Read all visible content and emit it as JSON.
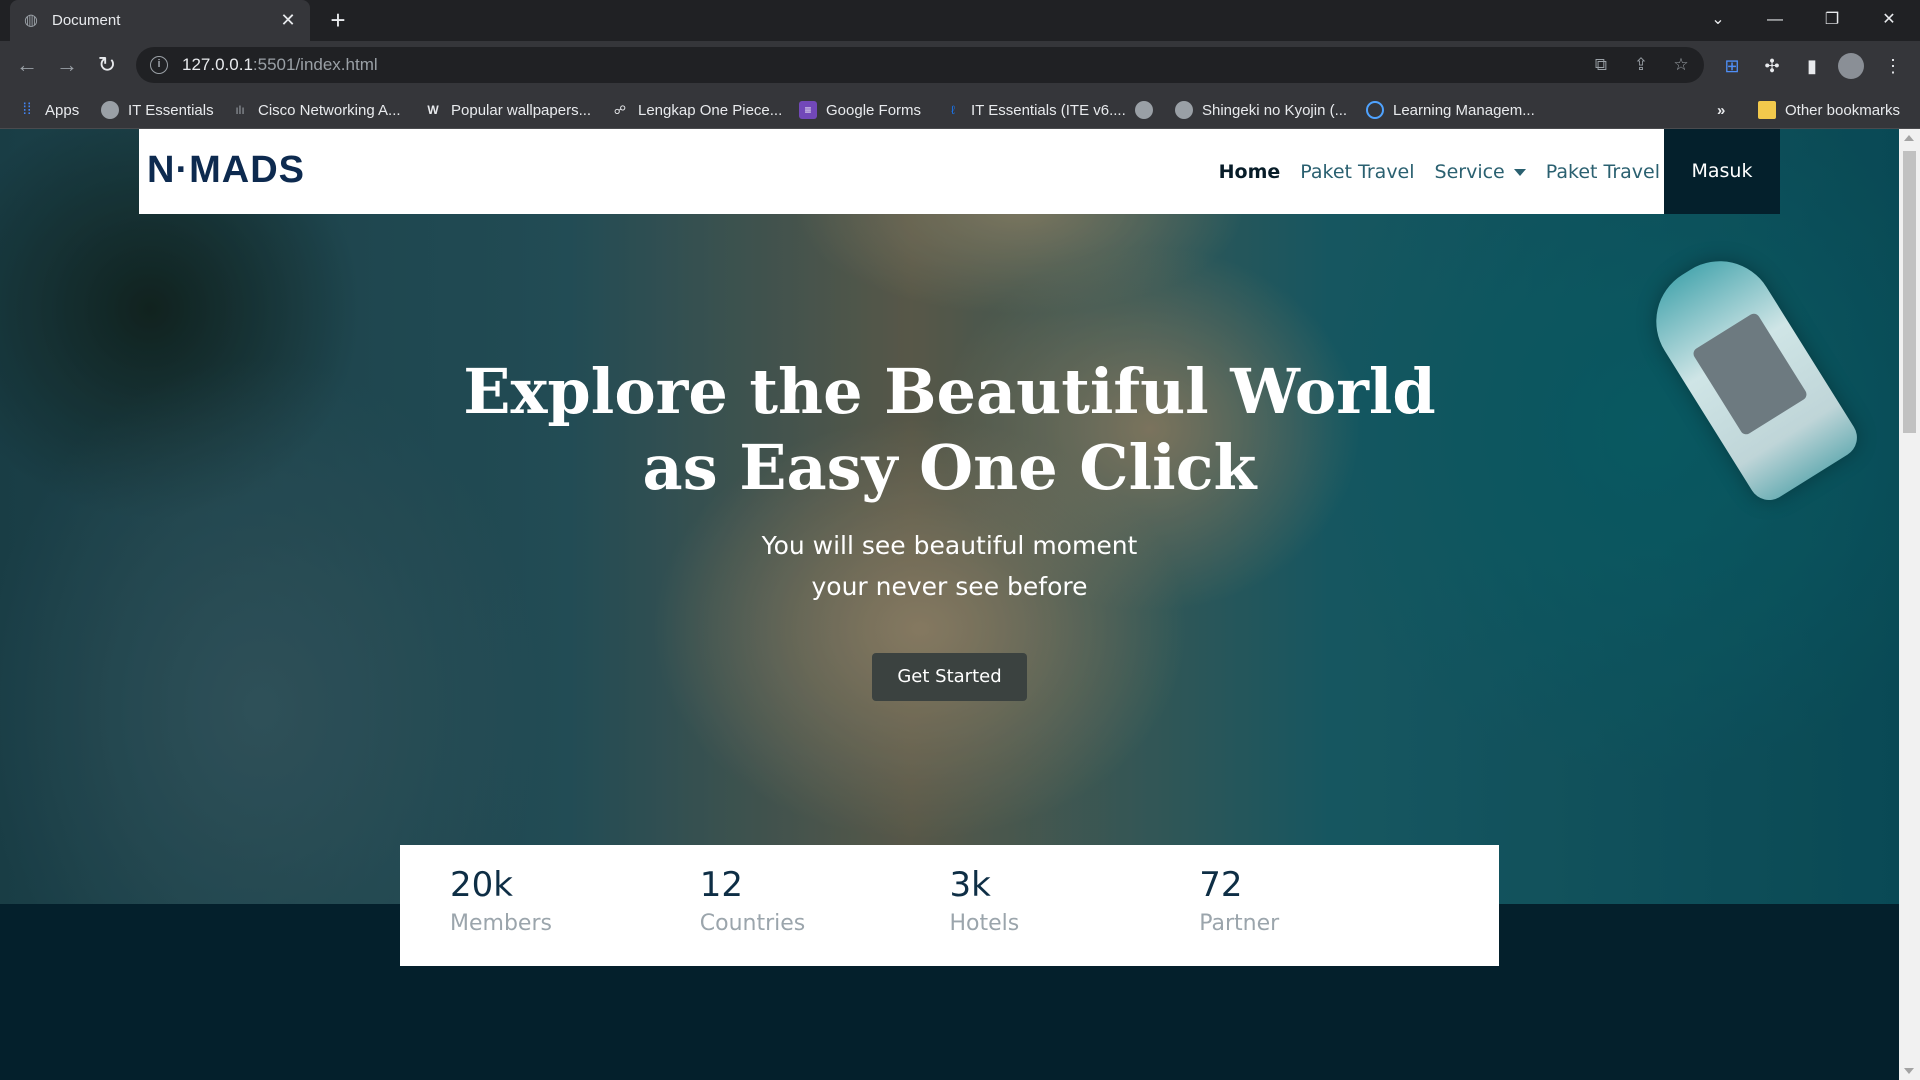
{
  "browser": {
    "tab_title": "Document",
    "url_host": "127.0.0.1",
    "url_path": ":5501/index.html",
    "bookmarks": [
      {
        "label": "Apps",
        "icon": "apps-grid-icon",
        "color": "#4285f4"
      },
      {
        "label": "IT Essentials",
        "icon": "globe-icon",
        "color": "#9aa0a6"
      },
      {
        "label": "Cisco Networking A...",
        "icon": "cisco-icon",
        "color": "#9aa0a6"
      },
      {
        "label": "Popular wallpapers...",
        "icon": "w-icon",
        "color": "#e8eaed"
      },
      {
        "label": "Lengkap One Piece...",
        "icon": "figure-icon",
        "color": "#e8eaed"
      },
      {
        "label": "Google Forms",
        "icon": "forms-icon",
        "color": "#7248b9"
      },
      {
        "label": "IT Essentials (ITE v6....",
        "icon": "link-icon",
        "color": "#1a73e8"
      },
      {
        "label": "",
        "icon": "globe-icon",
        "color": "#9aa0a6"
      },
      {
        "label": "Shingeki no Kyojin (...",
        "icon": "globe-icon",
        "color": "#9aa0a6"
      },
      {
        "label": "Learning Managem...",
        "icon": "circle-icon",
        "color": "#4fa3ff"
      }
    ],
    "bookmarks_overflow": "»",
    "other_bookmarks": "Other bookmarks"
  },
  "site": {
    "brand": "N·MADS",
    "nav": {
      "home": "Home",
      "paket_travel": "Paket Travel",
      "service": "Service",
      "paket_travel_2": "Paket Travel",
      "login": "Masuk"
    },
    "hero": {
      "headline_line1": "Explore the Beautiful World",
      "headline_line2": "as Easy One Click",
      "sub_line1": "You will see beautiful moment",
      "sub_line2": "your never see before",
      "cta": "Get Started"
    },
    "stats": [
      {
        "value": "20k",
        "label": "Members"
      },
      {
        "value": "12",
        "label": "Countries"
      },
      {
        "value": "3k",
        "label": "Hotels"
      },
      {
        "value": "72",
        "label": "Partner"
      }
    ],
    "colors": {
      "primary_dark": "#04202c",
      "nav_link": "#2a6070",
      "brand": "#0d2a4f",
      "cta_bg": "#3b4240"
    }
  }
}
